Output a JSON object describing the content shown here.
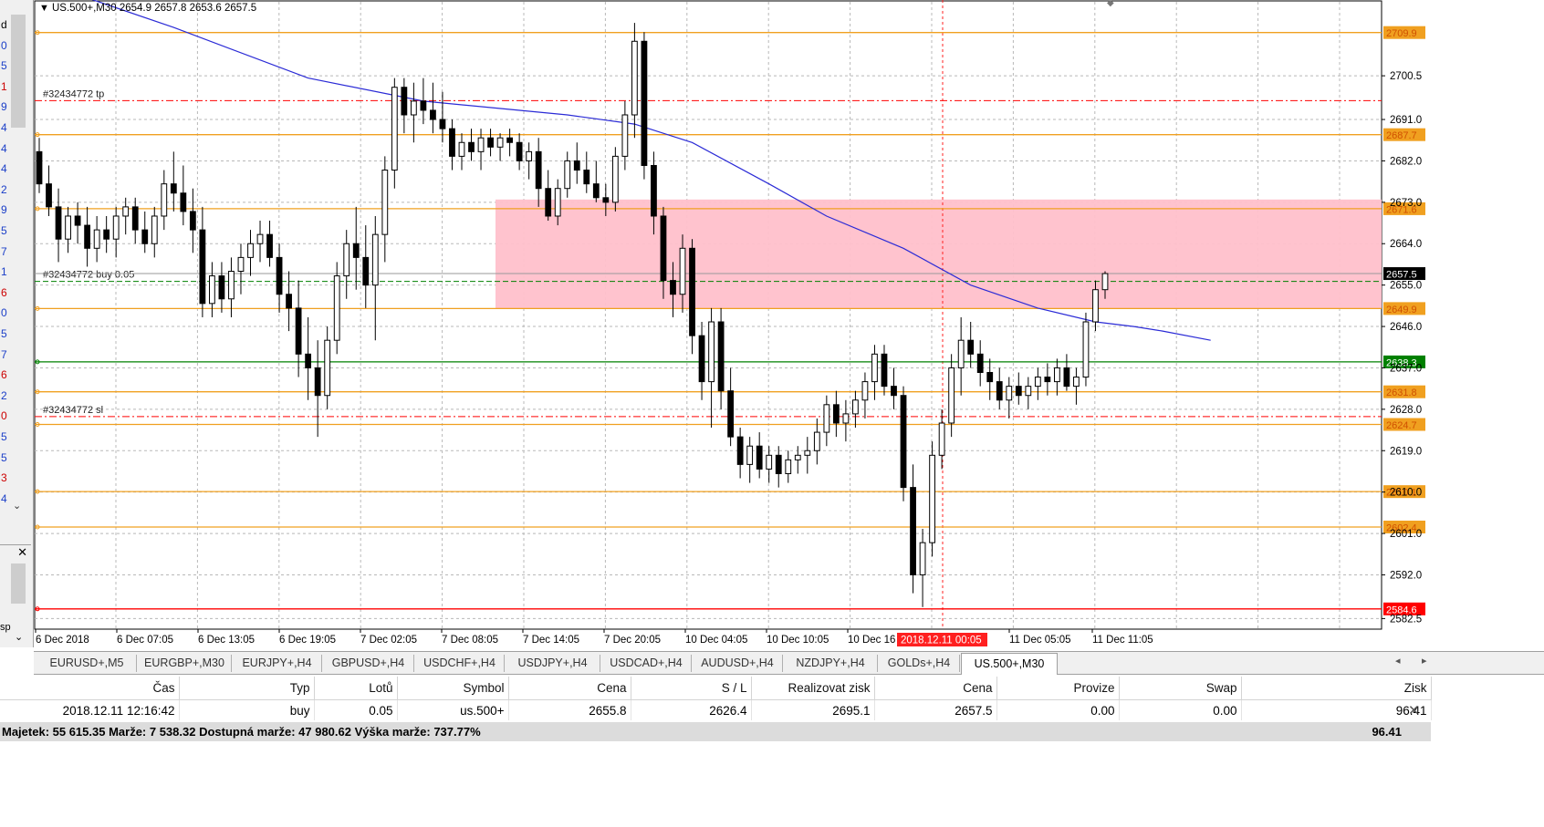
{
  "window": {
    "title": "US.500+,M30",
    "ohlc": "2654.9 2657.8 2653.6 2657.5"
  },
  "left_panel": {
    "chars": [
      "d",
      "0",
      "5",
      "1",
      "9",
      "4",
      "4",
      "4",
      "2",
      "9",
      "5",
      "7",
      "1",
      "6",
      "0",
      "5",
      "7",
      "6",
      "2",
      "0",
      "5",
      "5",
      "3",
      "4"
    ],
    "chars_colors": [
      "#000",
      "#1a3ec8",
      "#1a3ec8",
      "#c00",
      "#1a3ec8",
      "#1a3ec8",
      "#1a3ec8",
      "#1a3ec8",
      "#1a3ec8",
      "#1a3ec8",
      "#1a3ec8",
      "#1a3ec8",
      "#1a3ec8",
      "#c00",
      "#1a3ec8",
      "#1a3ec8",
      "#1a3ec8",
      "#c00",
      "#1a3ec8",
      "#c00",
      "#1a3ec8",
      "#1a3ec8",
      "#c00",
      "#1a3ec8"
    ],
    "sp_label": "sp"
  },
  "chart_data": {
    "type": "candlestick",
    "symbol": "US.500+",
    "timeframe": "M30",
    "ylim": [
      2580.2,
      2714.2
    ],
    "y_ticks": [
      2700.5,
      2691.0,
      2682.0,
      2673.0,
      2664.0,
      2655.0,
      2646.0,
      2637.0,
      2628.0,
      2619.0,
      2610.0,
      2601.0,
      2592.0,
      2582.5
    ],
    "x_tick_labels": [
      "6 Dec 2018",
      "6 Dec 07:05",
      "6 Dec 13:05",
      "6 Dec 19:05",
      "7 Dec 02:05",
      "7 Dec 08:05",
      "7 Dec 14:05",
      "7 Dec 20:05",
      "10 Dec 04:05",
      "10 Dec 10:05",
      "10 Dec 16",
      "11 Dec 05:05",
      "11 Dec 11:05"
    ],
    "crosshair_time_label": "2018.12.11 00:05",
    "horizontal_levels": [
      {
        "price": 2709.9,
        "label": "2709.9",
        "color": "#f0a020",
        "style": "solid"
      },
      {
        "price": 2687.7,
        "label": "2687.7",
        "color": "#f0a020",
        "style": "solid"
      },
      {
        "price": 2671.6,
        "label": "2671.6",
        "color": "#f0a020",
        "style": "solid"
      },
      {
        "price": 2649.9,
        "label": "2649.9",
        "color": "#f0a020",
        "style": "solid"
      },
      {
        "price": 2638.3,
        "label": "2638.3",
        "color": "#008000",
        "style": "solid"
      },
      {
        "price": 2631.8,
        "label": "2631.8",
        "color": "#f0a020",
        "style": "solid"
      },
      {
        "price": 2624.7,
        "label": "2624.7",
        "color": "#f0a020",
        "style": "solid"
      },
      {
        "price": 2610.1,
        "label": "2610.1",
        "color": "#f0a020",
        "style": "solid"
      },
      {
        "price": 2602.4,
        "label": "2602.4",
        "color": "#f0a020",
        "style": "solid"
      },
      {
        "price": 2584.6,
        "label": "2584.6",
        "color": "#ff0000",
        "style": "solid"
      }
    ],
    "current_price": {
      "price": 2657.5,
      "label": "2657.5"
    },
    "order_lines": [
      {
        "price": 2695.1,
        "label": "#32434772 tp",
        "color": "#ff0000"
      },
      {
        "price": 2655.8,
        "label": "#32434772 buy 0.05",
        "color": "#008000"
      },
      {
        "price": 2626.4,
        "label": "#32434772 sl",
        "color": "#ff0000"
      }
    ],
    "zone": {
      "from_price": 2649.9,
      "to_price": 2673.6,
      "color": "#ffc0cb"
    },
    "candles": [
      [
        2684,
        2687,
        2675,
        2677
      ],
      [
        2677,
        2681,
        2670,
        2672
      ],
      [
        2672,
        2676,
        2660,
        2665
      ],
      [
        2665,
        2672,
        2662,
        2670
      ],
      [
        2670,
        2673,
        2664,
        2668
      ],
      [
        2668,
        2672,
        2659,
        2663
      ],
      [
        2663,
        2670,
        2660,
        2667
      ],
      [
        2667,
        2670,
        2662,
        2665
      ],
      [
        2665,
        2672,
        2661,
        2670
      ],
      [
        2670,
        2674,
        2666,
        2672
      ],
      [
        2672,
        2674,
        2664,
        2667
      ],
      [
        2667,
        2671,
        2662,
        2664
      ],
      [
        2664,
        2672,
        2661,
        2670
      ],
      [
        2670,
        2680,
        2667,
        2677
      ],
      [
        2677,
        2684,
        2671,
        2675
      ],
      [
        2675,
        2681,
        2668,
        2671
      ],
      [
        2671,
        2676,
        2662,
        2667
      ],
      [
        2667,
        2672,
        2648,
        2651
      ],
      [
        2651,
        2660,
        2648,
        2657
      ],
      [
        2657,
        2660,
        2649,
        2652
      ],
      [
        2652,
        2661,
        2648,
        2658
      ],
      [
        2658,
        2664,
        2653,
        2661
      ],
      [
        2661,
        2667,
        2657,
        2664
      ],
      [
        2664,
        2669,
        2660,
        2666
      ],
      [
        2666,
        2669,
        2659,
        2661
      ],
      [
        2661,
        2664,
        2649,
        2653
      ],
      [
        2653,
        2658,
        2645,
        2650
      ],
      [
        2650,
        2656,
        2635,
        2640
      ],
      [
        2640,
        2648,
        2630,
        2637
      ],
      [
        2637,
        2643,
        2622,
        2631
      ],
      [
        2631,
        2646,
        2628,
        2643
      ],
      [
        2643,
        2660,
        2640,
        2657
      ],
      [
        2657,
        2667,
        2652,
        2664
      ],
      [
        2664,
        2672,
        2654,
        2661
      ],
      [
        2661,
        2668,
        2650,
        2655
      ],
      [
        2655,
        2670,
        2643,
        2666
      ],
      [
        2666,
        2683,
        2660,
        2680
      ],
      [
        2680,
        2700,
        2676,
        2698
      ],
      [
        2698,
        2700,
        2688,
        2692
      ],
      [
        2692,
        2699,
        2686,
        2695
      ],
      [
        2695,
        2700,
        2690,
        2693
      ],
      [
        2693,
        2699,
        2688,
        2691
      ],
      [
        2691,
        2697,
        2686,
        2689
      ],
      [
        2689,
        2691,
        2680,
        2683
      ],
      [
        2683,
        2688,
        2680,
        2686
      ],
      [
        2686,
        2689,
        2682,
        2684
      ],
      [
        2684,
        2689,
        2680,
        2687
      ],
      [
        2687,
        2689,
        2683,
        2685
      ],
      [
        2685,
        2688,
        2682,
        2687
      ],
      [
        2687,
        2689,
        2683,
        2686
      ],
      [
        2686,
        2688,
        2680,
        2682
      ],
      [
        2682,
        2686,
        2678,
        2684
      ],
      [
        2684,
        2687,
        2672,
        2676
      ],
      [
        2676,
        2680,
        2669,
        2670
      ],
      [
        2670,
        2678,
        2668,
        2676
      ],
      [
        2676,
        2684,
        2674,
        2682
      ],
      [
        2682,
        2686,
        2677,
        2680
      ],
      [
        2680,
        2684,
        2675,
        2677
      ],
      [
        2677,
        2682,
        2673,
        2674
      ],
      [
        2674,
        2677,
        2670,
        2673
      ],
      [
        2673,
        2685,
        2671,
        2683
      ],
      [
        2683,
        2695,
        2680,
        2692
      ],
      [
        2692,
        2712,
        2687,
        2708
      ],
      [
        2708,
        2710,
        2678,
        2681
      ],
      [
        2681,
        2684,
        2666,
        2670
      ],
      [
        2670,
        2672,
        2652,
        2656
      ],
      [
        2656,
        2660,
        2648,
        2653
      ],
      [
        2653,
        2666,
        2649,
        2663
      ],
      [
        2663,
        2665,
        2640,
        2644
      ],
      [
        2644,
        2647,
        2630,
        2634
      ],
      [
        2634,
        2650,
        2624,
        2647
      ],
      [
        2647,
        2650,
        2628,
        2632
      ],
      [
        2632,
        2637,
        2620,
        2622
      ],
      [
        2622,
        2624,
        2613,
        2616
      ],
      [
        2616,
        2622,
        2612,
        2620
      ],
      [
        2620,
        2623,
        2613,
        2615
      ],
      [
        2615,
        2620,
        2612,
        2618
      ],
      [
        2618,
        2620,
        2611,
        2614
      ],
      [
        2614,
        2619,
        2612,
        2617
      ],
      [
        2617,
        2620,
        2614,
        2618
      ],
      [
        2618,
        2622,
        2614,
        2619
      ],
      [
        2619,
        2626,
        2616,
        2623
      ],
      [
        2623,
        2631,
        2620,
        2629
      ],
      [
        2629,
        2632,
        2622,
        2625
      ],
      [
        2625,
        2630,
        2621,
        2627
      ],
      [
        2627,
        2632,
        2624,
        2630
      ],
      [
        2630,
        2636,
        2626,
        2634
      ],
      [
        2634,
        2642,
        2630,
        2640
      ],
      [
        2640,
        2642,
        2631,
        2633
      ],
      [
        2633,
        2637,
        2628,
        2631
      ],
      [
        2631,
        2633,
        2608,
        2611
      ],
      [
        2611,
        2616,
        2588,
        2592
      ],
      [
        2592,
        2602,
        2585,
        2599
      ],
      [
        2599,
        2621,
        2596,
        2618
      ],
      [
        2618,
        2628,
        2615,
        2625
      ],
      [
        2625,
        2640,
        2622,
        2637
      ],
      [
        2637,
        2648,
        2631,
        2643
      ],
      [
        2643,
        2647,
        2637,
        2640
      ],
      [
        2640,
        2643,
        2633,
        2636
      ],
      [
        2636,
        2639,
        2630,
        2634
      ],
      [
        2634,
        2637,
        2628,
        2630
      ],
      [
        2630,
        2635,
        2626,
        2633
      ],
      [
        2633,
        2636,
        2629,
        2631
      ],
      [
        2631,
        2635,
        2628,
        2633
      ],
      [
        2633,
        2637,
        2630,
        2635
      ],
      [
        2635,
        2638,
        2631,
        2634
      ],
      [
        2634,
        2639,
        2631,
        2637
      ],
      [
        2637,
        2640,
        2632,
        2633
      ],
      [
        2633,
        2637,
        2629,
        2635
      ],
      [
        2635,
        2649,
        2633,
        2647
      ],
      [
        2647,
        2656,
        2645,
        2654
      ],
      [
        2654,
        2658,
        2652,
        2657.5
      ]
    ],
    "ma_points": [
      [
        0,
        2721
      ],
      [
        14,
        2711
      ],
      [
        28,
        2700
      ],
      [
        40,
        2695
      ],
      [
        55,
        2692
      ],
      [
        62,
        2690
      ],
      [
        68,
        2686
      ],
      [
        76,
        2677
      ],
      [
        82,
        2670
      ],
      [
        90,
        2663
      ],
      [
        97,
        2655
      ],
      [
        104,
        2650
      ],
      [
        110,
        2647
      ],
      [
        114,
        2646
      ],
      [
        117,
        2645
      ],
      [
        122,
        2643
      ]
    ]
  },
  "tabs": {
    "items": [
      "EURUSD+,M5",
      "EURGBP+,M30",
      "EURJPY+,H4",
      "GBPUSD+,H4",
      "USDCHF+,H4",
      "USDJPY+,H4",
      "USDCAD+,H4",
      "AUDUSD+,H4",
      "NZDJPY+,H4",
      "GOLDs+,H4",
      "US.500+,M30"
    ],
    "active": "US.500+,M30"
  },
  "trade_table": {
    "headers": [
      "Čas",
      "Typ",
      "Lotů",
      "Symbol",
      "Cena",
      "S / L",
      "Realizovat zisk",
      "Cena",
      "Provize",
      "Swap",
      "Zisk"
    ],
    "rows": [
      [
        "2018.12.11 12:16:42",
        "buy",
        "0.05",
        "us.500+",
        "2655.8",
        "2626.4",
        "2695.1",
        "2657.5",
        "0.00",
        "0.00",
        "96.41"
      ]
    ]
  },
  "summary": {
    "text": "Majetek: 55 615.35  Marže: 7 538.32  Dostupná marže: 47 980.62  Výška marže: 737.77%",
    "profit": "96.41"
  },
  "colors": {
    "bull_candle": "#ffffff",
    "bear_candle": "#000000",
    "ma_line": "#2b2bd6",
    "grid": "#b8b8b8",
    "current_price_box": "#000000"
  }
}
